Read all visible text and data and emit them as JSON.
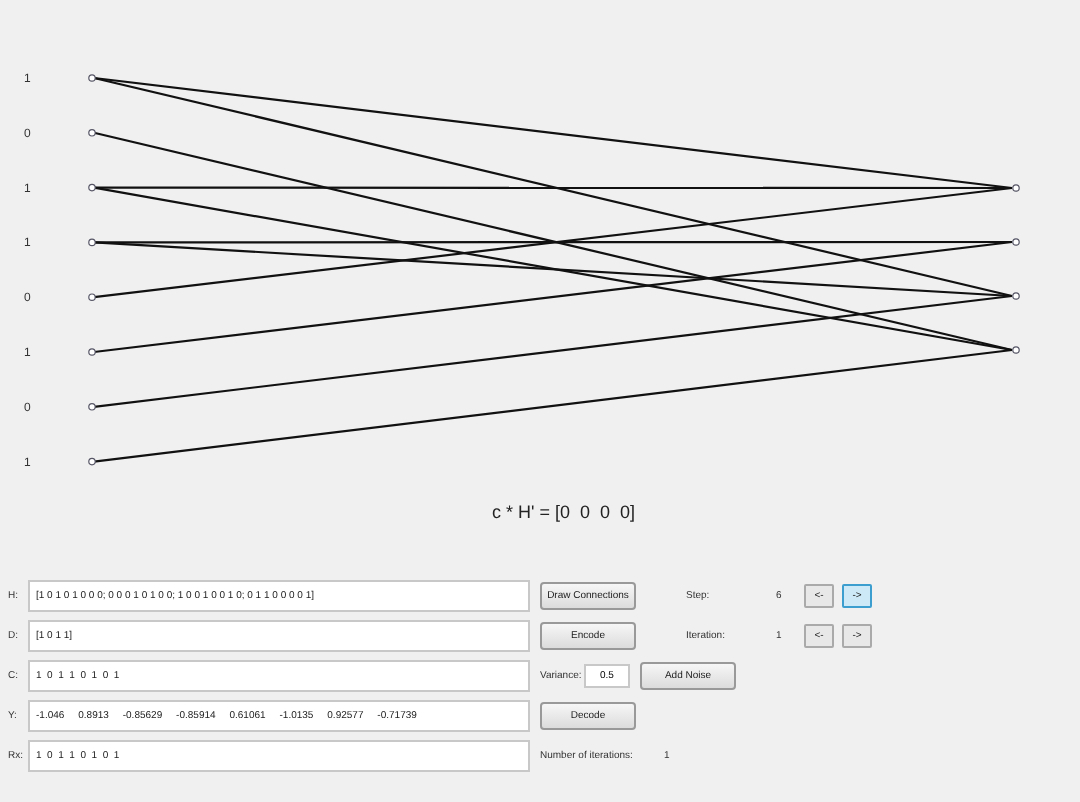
{
  "graph": {
    "variable_nodes": [
      {
        "bit": "1"
      },
      {
        "bit": "0"
      },
      {
        "bit": "1"
      },
      {
        "bit": "1"
      },
      {
        "bit": "0"
      },
      {
        "bit": "1"
      },
      {
        "bit": "0"
      },
      {
        "bit": "1"
      }
    ]
  },
  "parity_check": "c * H' = [0  0  0  0]",
  "rows": [
    {
      "label": "H:",
      "value": "[1 0 1 0 1 0 0 0; 0 0 0 1 0 1 0 0; 1 0 0 1 0 0 1 0; 0 1 1 0 0 0 0 1]",
      "right": [
        {
          "kind": "button",
          "text": "Draw Connections"
        },
        {
          "kind": "label",
          "text": "Step:"
        },
        {
          "kind": "value",
          "text": "6"
        },
        {
          "kind": "arrow",
          "text": "<-",
          "selected": false
        },
        {
          "kind": "arrow",
          "text": "->",
          "selected": true
        }
      ]
    },
    {
      "label": "D:",
      "value": "[1 0 1 1]",
      "right": [
        {
          "kind": "button",
          "text": "Encode"
        },
        {
          "kind": "label",
          "text": "Iteration:"
        },
        {
          "kind": "value",
          "text": "1"
        },
        {
          "kind": "arrow",
          "text": "<-",
          "selected": false
        },
        {
          "kind": "arrow",
          "text": "->",
          "selected": false
        }
      ]
    },
    {
      "label": "C:",
      "value": "1  0  1  1  0  1  0  1",
      "right": [
        {
          "kind": "label",
          "text": "Variance:"
        },
        {
          "kind": "input",
          "text": "0.5"
        },
        {
          "kind": "button",
          "text": "Add Noise"
        }
      ]
    },
    {
      "label": "Y:",
      "value": "-1.046     0.8913     -0.85629     -0.85914     0.61061     -1.0135     0.92577     -0.71739",
      "right": [
        {
          "kind": "button",
          "text": "Decode"
        }
      ]
    },
    {
      "label": "Rx:",
      "value": "1  0  1  1  0  1  0  1",
      "right": [
        {
          "kind": "label",
          "text": "Number of iterations:"
        },
        {
          "kind": "value",
          "text": "1"
        }
      ]
    }
  ]
}
